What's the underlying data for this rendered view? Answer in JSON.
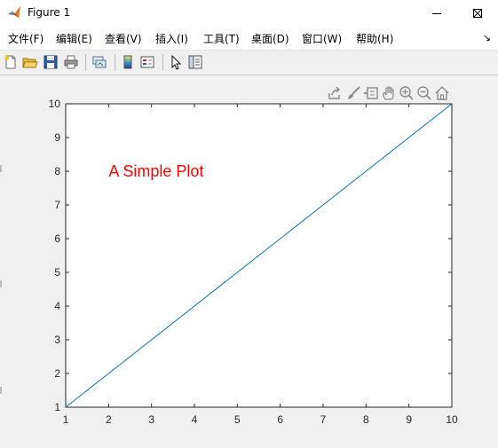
{
  "window": {
    "title": "Figure 1"
  },
  "menu": {
    "items": [
      "文件(F)",
      "编辑(E)",
      "查看(V)",
      "插入(I)",
      "工具(T)",
      "桌面(D)",
      "窗口(W)",
      "帮助(H)"
    ],
    "overflow_glyph": "↘"
  },
  "toolbar": {
    "icons": [
      "new-figure-icon",
      "open-file-icon",
      "save-figure-icon",
      "print-figure-icon",
      "link-plot-icon",
      "insert-colorbar-icon",
      "insert-legend-icon",
      "edit-plot-pointer-icon",
      "property-inspector-icon"
    ]
  },
  "axes_toolbar": {
    "icons": [
      "export-icon",
      "data-brush-icon",
      "data-tips-icon",
      "pan-hand-icon",
      "zoom-in-icon",
      "zoom-out-icon",
      "restore-view-icon"
    ]
  },
  "colors": {
    "line": "#0072bd",
    "annotation": "#ff0000",
    "axis": "#262626"
  },
  "chart_data": {
    "type": "line",
    "title": "",
    "xlabel": "",
    "ylabel": "",
    "xlim": [
      1,
      10
    ],
    "ylim": [
      1,
      10
    ],
    "xticks": [
      1,
      2,
      3,
      4,
      5,
      6,
      7,
      8,
      9,
      10
    ],
    "yticks": [
      1,
      2,
      3,
      4,
      5,
      6,
      7,
      8,
      9,
      10
    ],
    "grid": false,
    "series": [
      {
        "x": [
          1,
          2,
          3,
          4,
          5,
          6,
          7,
          8,
          9,
          10
        ],
        "y": [
          1,
          2,
          3,
          4,
          5,
          6,
          7,
          8,
          9,
          10
        ]
      }
    ],
    "annotations": [
      {
        "text": "A Simple Plot",
        "x": 2,
        "y": 8
      }
    ]
  }
}
